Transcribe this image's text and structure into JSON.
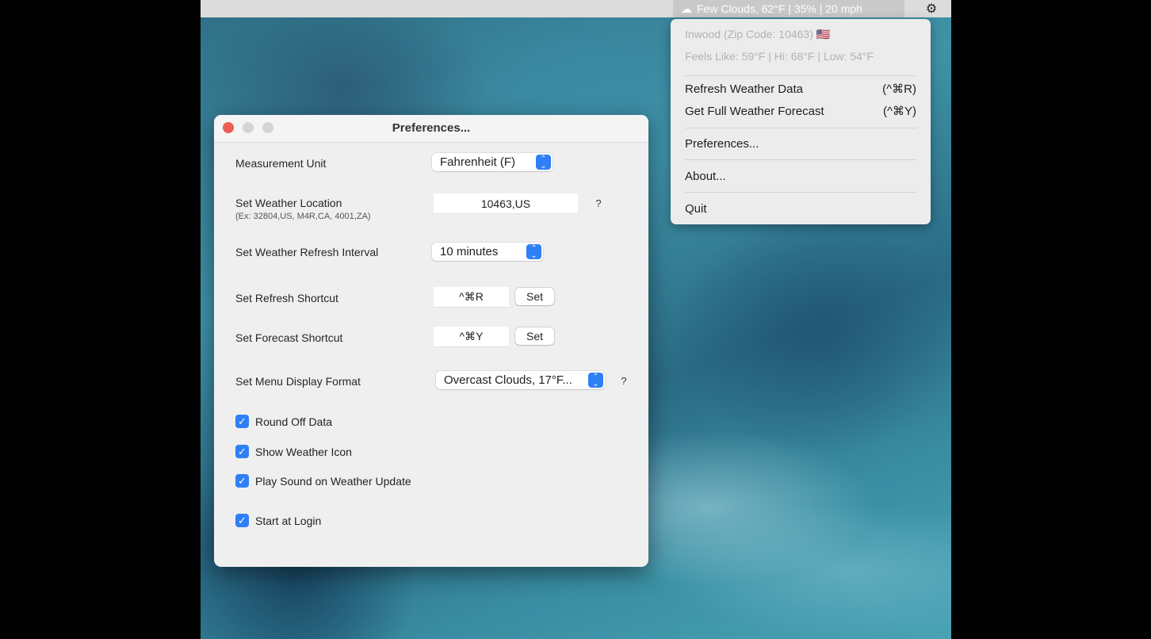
{
  "menubar": {
    "status_text": "Few Clouds, 62°F | 35% | 20 mph",
    "status_icon": "cloud-icon",
    "gear_icon": "gear-icon"
  },
  "dropdown": {
    "location": "Inwood (Zip Code: 10463) 🇺🇸",
    "details": "Feels Like: 59°F | Hi: 68°F | Low: 54°F",
    "items": [
      {
        "label": "Refresh Weather Data",
        "shortcut": "(^⌘R)"
      },
      {
        "label": "Get Full Weather Forecast",
        "shortcut": "(^⌘Y)"
      },
      {
        "label": "Preferences...",
        "shortcut": ""
      },
      {
        "label": "About...",
        "shortcut": ""
      },
      {
        "label": "Quit",
        "shortcut": ""
      }
    ]
  },
  "window": {
    "title": "Preferences...",
    "measurement_label": "Measurement Unit",
    "measurement_value": "Fahrenheit (F)",
    "location_label": "Set Weather Location",
    "location_hint": "(Ex: 32804,US, M4R,CA, 4001,ZA)",
    "location_value": "10463,US",
    "help_symbol": "?",
    "interval_label": "Set Weather Refresh Interval",
    "interval_value": "10 minutes",
    "refresh_shortcut_label": "Set Refresh Shortcut",
    "refresh_shortcut_value": "^⌘R",
    "forecast_shortcut_label": "Set Forecast Shortcut",
    "forecast_shortcut_value": "^⌘Y",
    "set_button": "Set",
    "format_label": "Set Menu Display Format",
    "format_value": "Overcast Clouds, 17°F...",
    "checkboxes": [
      {
        "label": "Round Off Data",
        "checked": true
      },
      {
        "label": "Show Weather Icon",
        "checked": true
      },
      {
        "label": "Play Sound on Weather Update",
        "checked": true
      },
      {
        "label": "Start at Login",
        "checked": true
      }
    ]
  },
  "colors": {
    "accent": "#2f7ff6",
    "close_button": "#ee5d56"
  }
}
